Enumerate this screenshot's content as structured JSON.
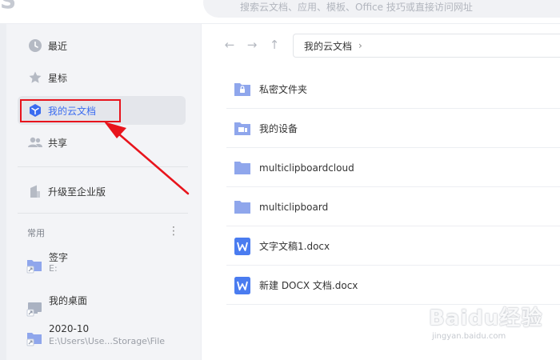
{
  "topbar": {
    "logo": "S",
    "search_placeholder": "搜索云文档、应用、模板、Office 技巧或直接访问网址"
  },
  "sidebar": {
    "nav": [
      {
        "label": "最近",
        "icon": "clock-icon"
      },
      {
        "label": "星标",
        "icon": "star-icon"
      },
      {
        "label": "我的云文档",
        "icon": "cloud-cube-icon",
        "active": true
      },
      {
        "label": "共享",
        "icon": "people-icon"
      }
    ],
    "upgrade_label": "升级至企业版",
    "section_label": "常用",
    "section_more": "⋮",
    "favorites": [
      {
        "name": "签字",
        "path": "E:",
        "icon": "folder-shortcut-icon"
      },
      {
        "name": "我的桌面",
        "path": "",
        "icon": "desktop-shortcut-icon"
      },
      {
        "name": "2020-10",
        "path": "E:\\Users\\Use...Storage\\File",
        "icon": "folder-shortcut-icon"
      }
    ]
  },
  "main": {
    "breadcrumb": {
      "current": "我的云文档",
      "sep": "›"
    },
    "nav_icons": {
      "back": "←",
      "forward": "→",
      "up": "↑"
    },
    "files": [
      {
        "name": "私密文件夹",
        "icon": "private-folder-icon"
      },
      {
        "name": "我的设备",
        "icon": "device-folder-icon"
      },
      {
        "name": "multiclipboardcloud",
        "icon": "folder-icon"
      },
      {
        "name": "multiclipboard",
        "icon": "folder-icon"
      },
      {
        "name": "文字文稿1.docx",
        "icon": "word-doc-icon"
      },
      {
        "name": "新建 DOCX 文档.docx",
        "icon": "word-doc-icon"
      }
    ]
  },
  "watermark": {
    "brand": "Baidu经验",
    "url": "jingyan.baidu.com"
  },
  "colors": {
    "accent": "#3a6cf0",
    "folder": "#8fa6ec",
    "highlight_red": "#e8141c",
    "sidebar_bg": "#f3f4f7"
  }
}
